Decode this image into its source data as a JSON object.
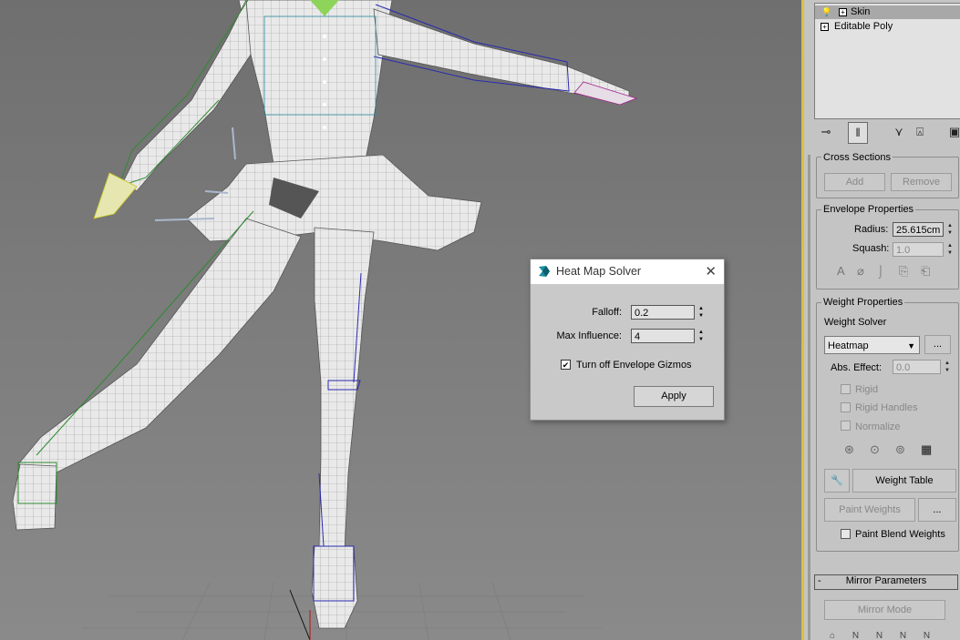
{
  "viewport": {
    "name": "3d-viewport"
  },
  "modifier_stack": {
    "items": [
      {
        "label": "Skin",
        "selected": true
      },
      {
        "label": "Editable Poly",
        "selected": false
      }
    ]
  },
  "stack_tools": {
    "pin_icon": "pin-icon",
    "show_end_icon": "show-end-result-icon",
    "unique_icon": "make-unique-icon",
    "remove_icon": "remove-modifier-icon",
    "configure_icon": "configure-modifier-sets-icon"
  },
  "cross_sections": {
    "title": "Cross Sections",
    "add": "Add",
    "remove": "Remove"
  },
  "envelope_properties": {
    "title": "Envelope Properties",
    "radius_label": "Radius:",
    "radius_value": "25.615cm",
    "squash_label": "Squash:",
    "squash_value": "1.0"
  },
  "weight_properties": {
    "title": "Weight Properties",
    "solver_label": "Weight Solver",
    "solver_value": "Heatmap",
    "solver_more": "...",
    "abs_effect_label": "Abs. Effect:",
    "abs_effect_value": "0.0",
    "rigid": "Rigid",
    "rigid_handles": "Rigid Handles",
    "normalize": "Normalize",
    "weight_table": "Weight Table",
    "paint_weights": "Paint Weights",
    "paint_more": "...",
    "paint_blend": "Paint Blend Weights"
  },
  "mirror_parameters": {
    "collapse": "-",
    "title": "Mirror Parameters",
    "mirror_mode": "Mirror Mode"
  },
  "dialog": {
    "title": "Heat Map Solver",
    "falloff_label": "Falloff:",
    "falloff_value": "0.2",
    "max_influence_label": "Max Influence:",
    "max_influence_value": "4",
    "gizmos_label": "Turn off Envelope Gizmos",
    "gizmos_checked": true,
    "apply": "Apply"
  }
}
